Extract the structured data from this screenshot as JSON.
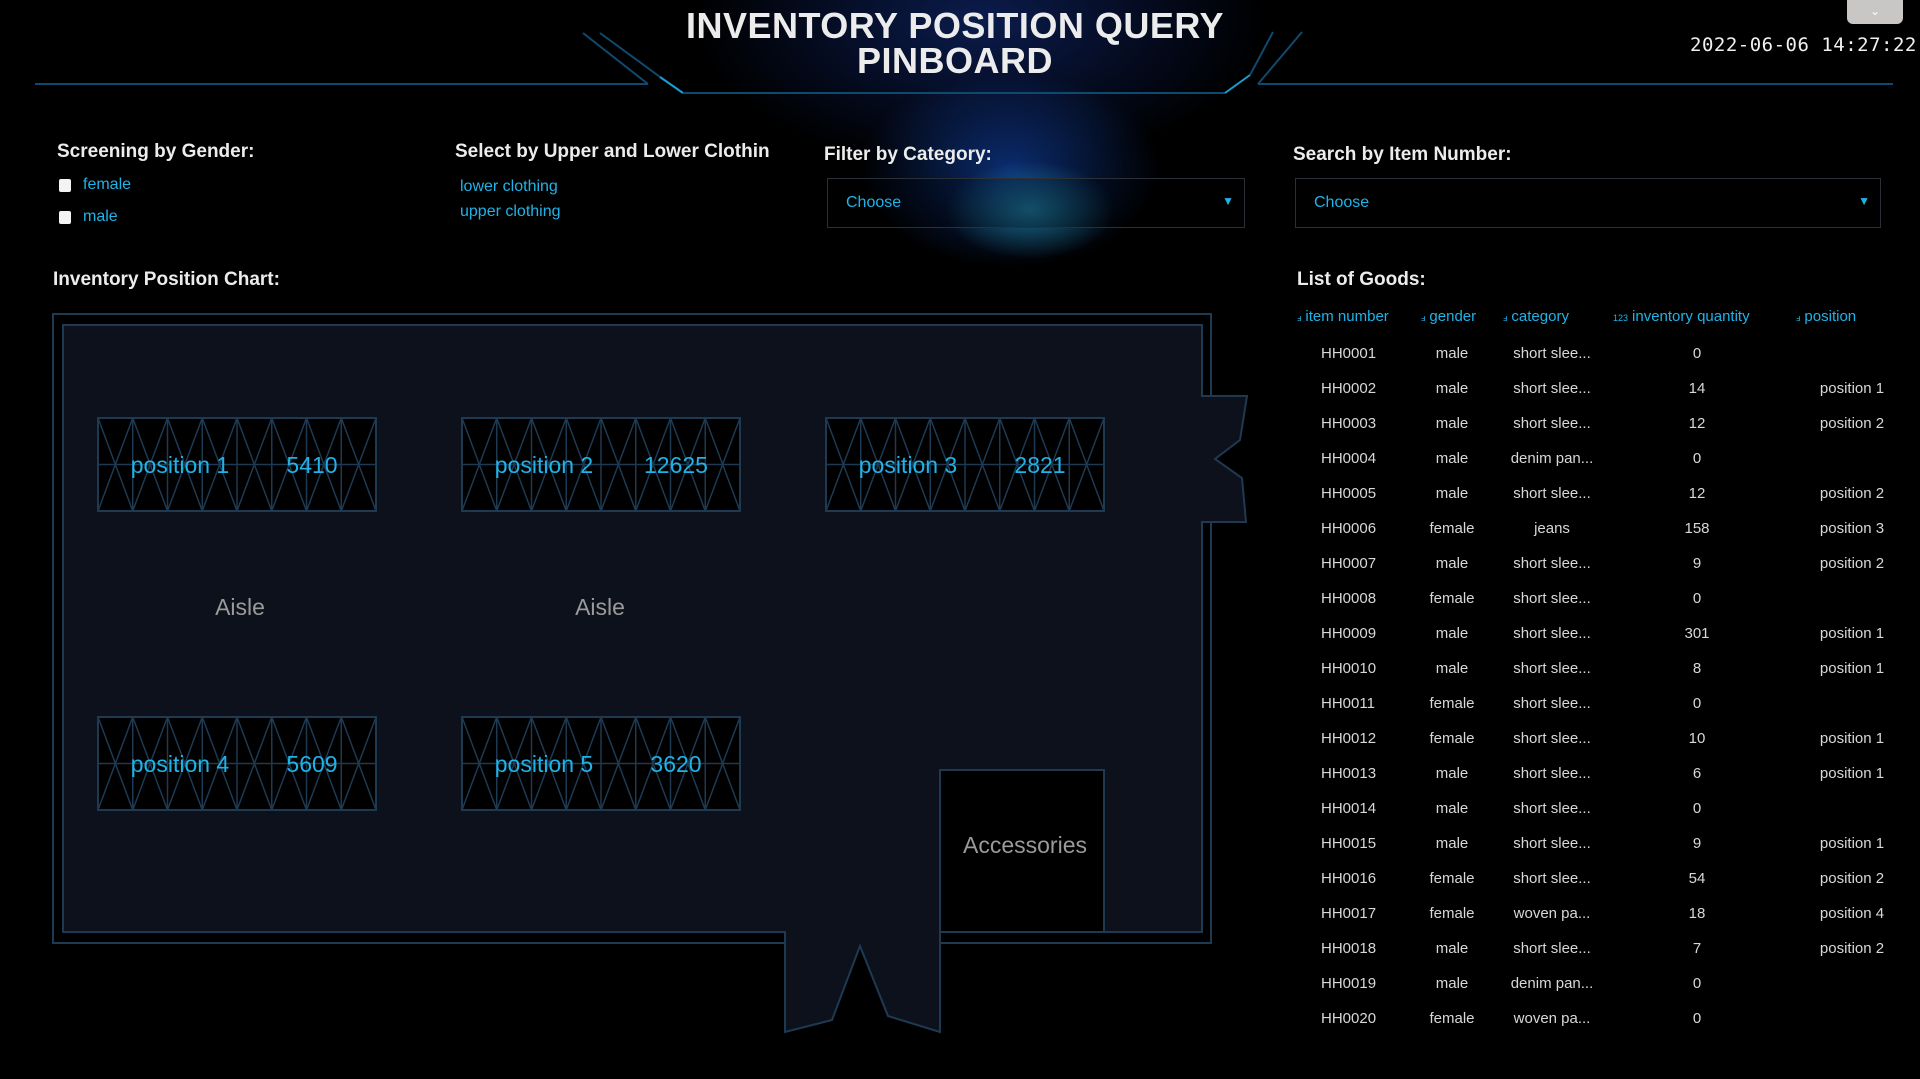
{
  "header": {
    "title_line1": "INVENTORY POSITION QUERY",
    "title_line2": "PINBOARD",
    "datetime": "2022-06-06  14:27:22",
    "corner_button_icon": "chevron-down-icon",
    "corner_button_glyph": "⌄"
  },
  "filters": {
    "gender": {
      "label": "Screening by Gender:",
      "options": [
        {
          "label": "female",
          "checked": false
        },
        {
          "label": "male",
          "checked": false
        }
      ]
    },
    "clothing": {
      "label": "Select by Upper and Lower Clothin",
      "options": [
        "lower clothing",
        "upper clothing"
      ]
    },
    "category": {
      "label": "Filter by Category:",
      "value": "Choose",
      "arrow": "▼"
    },
    "item_number": {
      "label": "Search by Item Number:",
      "value": "Choose",
      "arrow": "▼"
    }
  },
  "map": {
    "label": "Inventory Position Chart:",
    "racks": [
      {
        "name": "position 1",
        "quantity": "5410"
      },
      {
        "name": "position 2",
        "quantity": "12625"
      },
      {
        "name": "position 3",
        "quantity": "2821"
      },
      {
        "name": "position 4",
        "quantity": "5609"
      },
      {
        "name": "position 5",
        "quantity": "3620"
      }
    ],
    "aisles": [
      "Aisle",
      "Aisle"
    ],
    "accessories": "Accessories",
    "colors": {
      "floor": "#0d111b",
      "wall": "#1e3a52",
      "rack_text": "#1fb3e8",
      "label_text": "#9a9a9a"
    }
  },
  "goods": {
    "label": "List of Goods:",
    "columns": [
      {
        "type_icon": "ⅎ",
        "label": "item number"
      },
      {
        "type_icon": "ⅎ",
        "label": "gender"
      },
      {
        "type_icon": "ⅎ",
        "label": "category"
      },
      {
        "type_icon": "123",
        "label": "inventory quantity"
      },
      {
        "type_icon": "ⅎ",
        "label": "position"
      }
    ],
    "rows": [
      {
        "id": "HH0001",
        "gender": "male",
        "category": "short slee...",
        "qty": "0",
        "position": ""
      },
      {
        "id": "HH0002",
        "gender": "male",
        "category": "short slee...",
        "qty": "14",
        "position": "position 1"
      },
      {
        "id": "HH0003",
        "gender": "male",
        "category": "short slee...",
        "qty": "12",
        "position": "position 2"
      },
      {
        "id": "HH0004",
        "gender": "male",
        "category": "denim pan...",
        "qty": "0",
        "position": ""
      },
      {
        "id": "HH0005",
        "gender": "male",
        "category": "short slee...",
        "qty": "12",
        "position": "position 2"
      },
      {
        "id": "HH0006",
        "gender": "female",
        "category": "jeans",
        "qty": "158",
        "position": "position 3"
      },
      {
        "id": "HH0007",
        "gender": "male",
        "category": "short slee...",
        "qty": "9",
        "position": "position 2"
      },
      {
        "id": "HH0008",
        "gender": "female",
        "category": "short slee...",
        "qty": "0",
        "position": ""
      },
      {
        "id": "HH0009",
        "gender": "male",
        "category": "short slee...",
        "qty": "301",
        "position": "position 1"
      },
      {
        "id": "HH0010",
        "gender": "male",
        "category": "short slee...",
        "qty": "8",
        "position": "position 1"
      },
      {
        "id": "HH0011",
        "gender": "female",
        "category": "short slee...",
        "qty": "0",
        "position": ""
      },
      {
        "id": "HH0012",
        "gender": "female",
        "category": "short slee...",
        "qty": "10",
        "position": "position 1"
      },
      {
        "id": "HH0013",
        "gender": "male",
        "category": "short slee...",
        "qty": "6",
        "position": "position 1"
      },
      {
        "id": "HH0014",
        "gender": "male",
        "category": "short slee...",
        "qty": "0",
        "position": ""
      },
      {
        "id": "HH0015",
        "gender": "male",
        "category": "short slee...",
        "qty": "9",
        "position": "position 1"
      },
      {
        "id": "HH0016",
        "gender": "female",
        "category": "short slee...",
        "qty": "54",
        "position": "position 2"
      },
      {
        "id": "HH0017",
        "gender": "female",
        "category": "woven pa...",
        "qty": "18",
        "position": "position 4"
      },
      {
        "id": "HH0018",
        "gender": "male",
        "category": "short slee...",
        "qty": "7",
        "position": "position 2"
      },
      {
        "id": "HH0019",
        "gender": "male",
        "category": "denim pan...",
        "qty": "0",
        "position": ""
      },
      {
        "id": "HH0020",
        "gender": "female",
        "category": "woven pa...",
        "qty": "0",
        "position": ""
      }
    ]
  },
  "theme": {
    "accent": "#1fb3e8",
    "header_line": "#0f4a6e",
    "header_line_bright": "#1a9fd0"
  }
}
